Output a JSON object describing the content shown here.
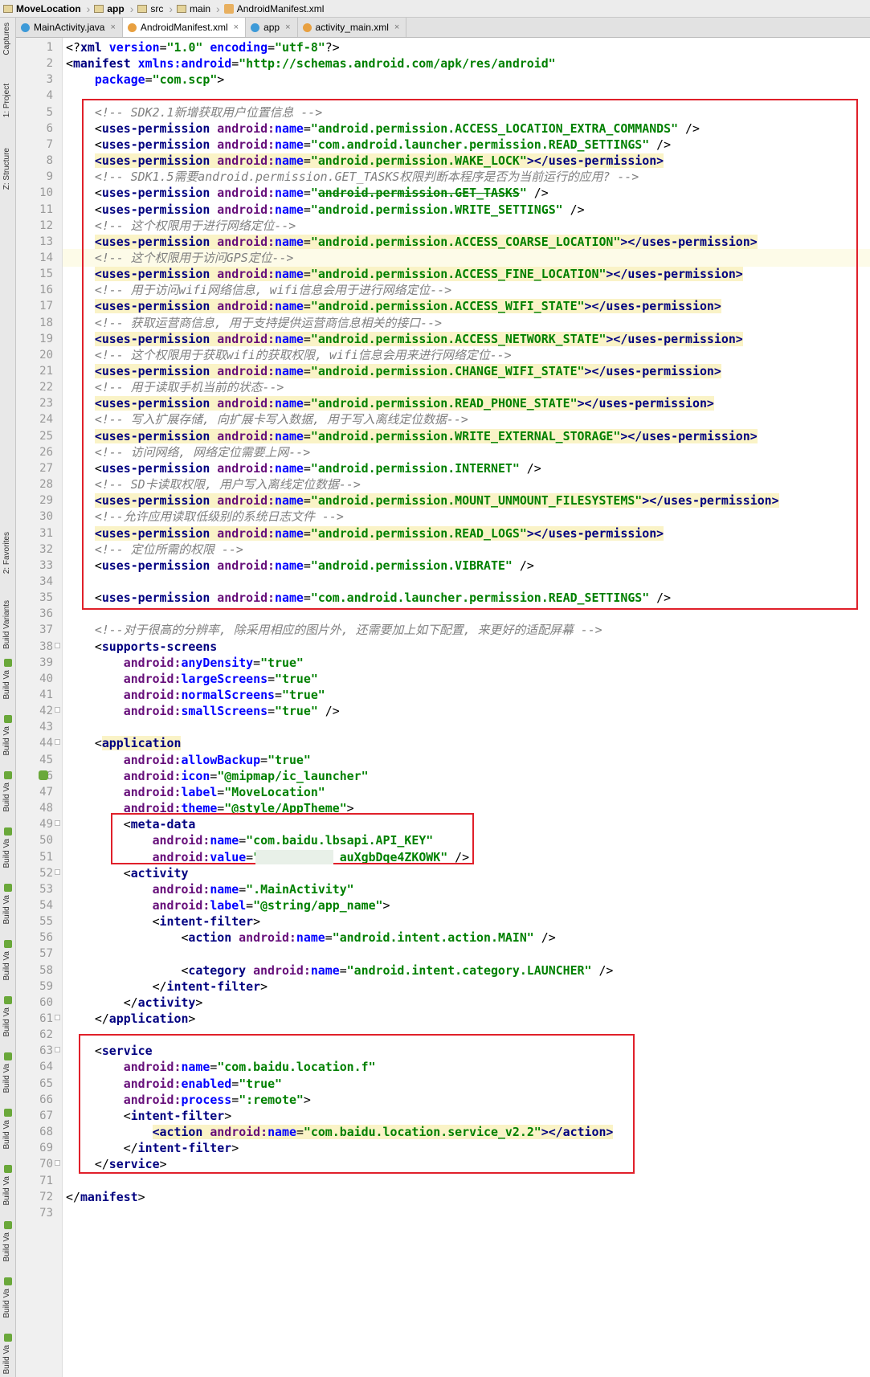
{
  "breadcrumb": [
    {
      "label": "MoveLocation",
      "type": "folder",
      "bold": true
    },
    {
      "label": "app",
      "type": "folder",
      "bold": true
    },
    {
      "label": "src",
      "type": "folder",
      "bold": false
    },
    {
      "label": "main",
      "type": "folder",
      "bold": false
    },
    {
      "label": "AndroidManifest.xml",
      "type": "xml",
      "bold": false
    }
  ],
  "tabs": [
    {
      "label": "MainActivity.java",
      "icon_color": "#3d9ad8",
      "active": false
    },
    {
      "label": "AndroidManifest.xml",
      "icon_color": "#e8a040",
      "active": true
    },
    {
      "label": "app",
      "icon_color": "#3d9ad8",
      "active": false
    },
    {
      "label": "activity_main.xml",
      "icon_color": "#e8a040",
      "active": false
    }
  ],
  "tool_windows": {
    "captures": "Captures",
    "project": "1: Project",
    "structure": "Z: Structure",
    "favorites": "2: Favorites",
    "build_variants": "Build Variants",
    "build_va": "Build Va"
  },
  "colors": {
    "tag": "#000080",
    "attr": "#0000ff",
    "namespace": "#660e7a",
    "value": "#008000",
    "comment": "#808080",
    "highlight": "#faf3c7",
    "annotation_box": "#e0202a"
  },
  "current_line": 14,
  "lines": [
    [
      [
        "pi",
        "<?"
      ],
      [
        "tg",
        "xml"
      ],
      [
        "an",
        " version"
      ],
      [
        "pi",
        "="
      ],
      [
        "av",
        "\"1.0\""
      ],
      [
        "an",
        " encoding"
      ],
      [
        "pi",
        "="
      ],
      [
        "av",
        "\"utf-8\""
      ],
      [
        "pi",
        "?>"
      ]
    ],
    [
      [
        "pi",
        "<"
      ],
      [
        "tg",
        "manifest "
      ],
      [
        "an",
        "xmlns:android"
      ],
      [
        "pi",
        "="
      ],
      [
        "av",
        "\"http://schemas.android.com/apk/res/android\""
      ]
    ],
    [
      [
        "pi",
        "    "
      ],
      [
        "an",
        "package"
      ],
      [
        "pi",
        "="
      ],
      [
        "av",
        "\"com.scp\""
      ],
      [
        "pi",
        ">"
      ]
    ],
    [],
    [
      [
        "cm",
        "    <!-- SDK2.1新增获取用户位置信息 -->"
      ]
    ],
    [
      [
        "pi",
        "    <"
      ],
      [
        "tg",
        "uses-permission "
      ],
      [
        "ns",
        "android:"
      ],
      [
        "an",
        "name"
      ],
      [
        "pi",
        "="
      ],
      [
        "av",
        "\"android.permission.ACCESS_LOCATION_EXTRA_COMMANDS\""
      ],
      [
        "pi",
        " />"
      ]
    ],
    [
      [
        "pi",
        "    <"
      ],
      [
        "tg",
        "uses-permission "
      ],
      [
        "ns",
        "android:"
      ],
      [
        "an",
        "name"
      ],
      [
        "pi",
        "="
      ],
      [
        "av",
        "\"com.android.launcher.permission.READ_SETTINGS\""
      ],
      [
        "pi",
        " />"
      ]
    ],
    [
      [
        "pi",
        "    "
      ],
      [
        "hl|tg",
        "<uses-permission "
      ],
      [
        "hl|ns",
        "android:"
      ],
      [
        "hl|an",
        "name"
      ],
      [
        "hl|pi",
        "="
      ],
      [
        "hl|av",
        "\"android.permission.WAKE_LOCK\""
      ],
      [
        "hl|tg",
        "></uses-permission>"
      ]
    ],
    [
      [
        "cm",
        "    <!-- SDK1.5需要android.permission.GET_TASKS权限判断本程序是否为当前运行的应用? -->"
      ]
    ],
    [
      [
        "pi",
        "    <"
      ],
      [
        "tg",
        "uses-permission "
      ],
      [
        "ns",
        "android:"
      ],
      [
        "an",
        "name"
      ],
      [
        "pi",
        "="
      ],
      [
        "av",
        "\""
      ],
      [
        "st|av",
        "android.permission.GET_TASKS"
      ],
      [
        "av",
        "\""
      ],
      [
        "pi",
        " />"
      ]
    ],
    [
      [
        "pi",
        "    <"
      ],
      [
        "tg",
        "uses-permission "
      ],
      [
        "ns",
        "android:"
      ],
      [
        "an",
        "name"
      ],
      [
        "pi",
        "="
      ],
      [
        "av",
        "\"android.permission.WRITE_SETTINGS\""
      ],
      [
        "pi",
        " />"
      ]
    ],
    [
      [
        "cm",
        "    <!-- 这个权限用于进行网络定位-->"
      ]
    ],
    [
      [
        "pi",
        "    "
      ],
      [
        "hl|tg",
        "<uses-permission "
      ],
      [
        "hl|ns",
        "android:"
      ],
      [
        "hl|an",
        "name"
      ],
      [
        "hl|pi",
        "="
      ],
      [
        "hl|av",
        "\"android.permission.ACCESS_COARSE_LOCATION\""
      ],
      [
        "hl|tg",
        "></uses-permission>"
      ]
    ],
    [
      [
        "cm",
        "    <!-- 这个权限用于访问GPS定位-->"
      ]
    ],
    [
      [
        "pi",
        "    "
      ],
      [
        "hl|tg",
        "<uses-permission "
      ],
      [
        "hl|ns",
        "android:"
      ],
      [
        "hl|an",
        "name"
      ],
      [
        "hl|pi",
        "="
      ],
      [
        "hl|av",
        "\"android.permission.ACCESS_FINE_LOCATION\""
      ],
      [
        "hl|tg",
        "></uses-permission>"
      ]
    ],
    [
      [
        "cm",
        "    <!-- 用于访问wifi网络信息, wifi信息会用于进行网络定位-->"
      ]
    ],
    [
      [
        "pi",
        "    "
      ],
      [
        "hl|tg",
        "<uses-permission "
      ],
      [
        "hl|ns",
        "android:"
      ],
      [
        "hl|an",
        "name"
      ],
      [
        "hl|pi",
        "="
      ],
      [
        "hl|av",
        "\"android.permission.ACCESS_WIFI_STATE\""
      ],
      [
        "hl|tg",
        "></uses-permission>"
      ]
    ],
    [
      [
        "cm",
        "    <!-- 获取运营商信息, 用于支持提供运营商信息相关的接口-->"
      ]
    ],
    [
      [
        "pi",
        "    "
      ],
      [
        "hl|tg",
        "<uses-permission "
      ],
      [
        "hl|ns",
        "android:"
      ],
      [
        "hl|an",
        "name"
      ],
      [
        "hl|pi",
        "="
      ],
      [
        "hl|av",
        "\"android.permission.ACCESS_NETWORK_STATE\""
      ],
      [
        "hl|tg",
        "></uses-permission>"
      ]
    ],
    [
      [
        "cm",
        "    <!-- 这个权限用于获取wifi的获取权限, wifi信息会用来进行网络定位-->"
      ]
    ],
    [
      [
        "pi",
        "    "
      ],
      [
        "hl|tg",
        "<uses-permission "
      ],
      [
        "hl|ns",
        "android:"
      ],
      [
        "hl|an",
        "name"
      ],
      [
        "hl|pi",
        "="
      ],
      [
        "hl|av",
        "\"android.permission.CHANGE_WIFI_STATE\""
      ],
      [
        "hl|tg",
        "></uses-permission>"
      ]
    ],
    [
      [
        "cm",
        "    <!-- 用于读取手机当前的状态-->"
      ]
    ],
    [
      [
        "pi",
        "    "
      ],
      [
        "hl|tg",
        "<uses-permission "
      ],
      [
        "hl|ns",
        "android:"
      ],
      [
        "hl|an",
        "name"
      ],
      [
        "hl|pi",
        "="
      ],
      [
        "hl|av",
        "\"android.permission.READ_PHONE_STATE\""
      ],
      [
        "hl|tg",
        "></uses-permission>"
      ]
    ],
    [
      [
        "cm",
        "    <!-- 写入扩展存储, 向扩展卡写入数据, 用于写入离线定位数据-->"
      ]
    ],
    [
      [
        "pi",
        "    "
      ],
      [
        "hl|tg",
        "<uses-permission "
      ],
      [
        "hl|ns",
        "android:"
      ],
      [
        "hl|an",
        "name"
      ],
      [
        "hl|pi",
        "="
      ],
      [
        "hl|av",
        "\"android.permission.WRITE_EXTERNAL_STORAGE\""
      ],
      [
        "hl|tg",
        "></uses-permission>"
      ]
    ],
    [
      [
        "cm",
        "    <!-- 访问网络, 网络定位需要上网-->"
      ]
    ],
    [
      [
        "pi",
        "    <"
      ],
      [
        "tg",
        "uses-permission "
      ],
      [
        "ns",
        "android:"
      ],
      [
        "an",
        "name"
      ],
      [
        "pi",
        "="
      ],
      [
        "av",
        "\"android.permission.INTERNET\""
      ],
      [
        "pi",
        " />"
      ]
    ],
    [
      [
        "cm",
        "    <!-- SD卡读取权限, 用户写入离线定位数据-->"
      ]
    ],
    [
      [
        "pi",
        "    "
      ],
      [
        "hl|tg",
        "<uses-permission "
      ],
      [
        "hl|ns",
        "android:"
      ],
      [
        "hl|an",
        "name"
      ],
      [
        "hl|pi",
        "="
      ],
      [
        "hl|av",
        "\"android.permission.MOUNT_UNMOUNT_FILESYSTEMS\""
      ],
      [
        "hl|tg",
        "></uses-permission>"
      ]
    ],
    [
      [
        "cm",
        "    <!--允许应用读取低级别的系统日志文件 -->"
      ]
    ],
    [
      [
        "pi",
        "    "
      ],
      [
        "hl|tg",
        "<uses-permission "
      ],
      [
        "hl|ns",
        "android:"
      ],
      [
        "hl|an",
        "name"
      ],
      [
        "hl|pi",
        "="
      ],
      [
        "hl|av",
        "\"android.permission.READ_LOGS\""
      ],
      [
        "hl|tg",
        "></uses-permission>"
      ]
    ],
    [
      [
        "cm",
        "    <!-- 定位所需的权限 -->"
      ]
    ],
    [
      [
        "pi",
        "    <"
      ],
      [
        "tg",
        "uses-permission "
      ],
      [
        "ns",
        "android:"
      ],
      [
        "an",
        "name"
      ],
      [
        "pi",
        "="
      ],
      [
        "av",
        "\"android.permission.VIBRATE\""
      ],
      [
        "pi",
        " />"
      ]
    ],
    [],
    [
      [
        "pi",
        "    <"
      ],
      [
        "tg",
        "uses-permission "
      ],
      [
        "ns",
        "android:"
      ],
      [
        "an",
        "name"
      ],
      [
        "pi",
        "="
      ],
      [
        "av",
        "\"com.android.launcher.permission.READ_SETTINGS\""
      ],
      [
        "pi",
        " />"
      ]
    ],
    [],
    [
      [
        "cm",
        "    <!--对于很高的分辨率, 除采用相应的图片外, 还需要加上如下配置, 来更好的适配屏幕 -->"
      ]
    ],
    [
      [
        "pi",
        "    <"
      ],
      [
        "tg",
        "supports-screens"
      ]
    ],
    [
      [
        "pi",
        "        "
      ],
      [
        "ns",
        "android:"
      ],
      [
        "an",
        "anyDensity"
      ],
      [
        "pi",
        "="
      ],
      [
        "av",
        "\"true\""
      ]
    ],
    [
      [
        "pi",
        "        "
      ],
      [
        "ns",
        "android:"
      ],
      [
        "an",
        "largeScreens"
      ],
      [
        "pi",
        "="
      ],
      [
        "av",
        "\"true\""
      ]
    ],
    [
      [
        "pi",
        "        "
      ],
      [
        "ns",
        "android:"
      ],
      [
        "an",
        "normalScreens"
      ],
      [
        "pi",
        "="
      ],
      [
        "av",
        "\"true\""
      ]
    ],
    [
      [
        "pi",
        "        "
      ],
      [
        "ns",
        "android:"
      ],
      [
        "an",
        "smallScreens"
      ],
      [
        "pi",
        "="
      ],
      [
        "av",
        "\"true\""
      ],
      [
        "pi",
        " />"
      ]
    ],
    [],
    [
      [
        "pi",
        "    <"
      ],
      [
        "hl|tg",
        "application"
      ]
    ],
    [
      [
        "pi",
        "        "
      ],
      [
        "ns",
        "android:"
      ],
      [
        "an",
        "allowBackup"
      ],
      [
        "pi",
        "="
      ],
      [
        "av",
        "\"true\""
      ]
    ],
    [
      [
        "pi",
        "        "
      ],
      [
        "ns",
        "android:"
      ],
      [
        "an",
        "icon"
      ],
      [
        "pi",
        "="
      ],
      [
        "av",
        "\"@mipmap/ic_launcher\""
      ]
    ],
    [
      [
        "pi",
        "        "
      ],
      [
        "ns",
        "android:"
      ],
      [
        "an",
        "label"
      ],
      [
        "pi",
        "="
      ],
      [
        "av",
        "\"MoveLocation\""
      ]
    ],
    [
      [
        "pi",
        "        "
      ],
      [
        "ns",
        "android:"
      ],
      [
        "an",
        "theme"
      ],
      [
        "pi",
        "="
      ],
      [
        "av",
        "\"@style/AppTheme\""
      ],
      [
        "pi",
        ">"
      ]
    ],
    [
      [
        "pi",
        "        <"
      ],
      [
        "tg",
        "meta-data"
      ]
    ],
    [
      [
        "pi",
        "            "
      ],
      [
        "ns",
        "android:"
      ],
      [
        "an",
        "name"
      ],
      [
        "pi",
        "="
      ],
      [
        "av",
        "\"com.baidu.lbsapi.API_KEY\""
      ]
    ],
    [
      [
        "pi",
        "            "
      ],
      [
        "ns",
        "android:"
      ],
      [
        "an",
        "value"
      ],
      [
        "pi",
        "="
      ],
      [
        "av",
        "\"           auXgbDqe4ZKOWK\""
      ],
      [
        "pi",
        " />"
      ]
    ],
    [
      [
        "pi",
        "        <"
      ],
      [
        "tg",
        "activity"
      ]
    ],
    [
      [
        "pi",
        "            "
      ],
      [
        "ns",
        "android:"
      ],
      [
        "an",
        "name"
      ],
      [
        "pi",
        "="
      ],
      [
        "av",
        "\".MainActivity\""
      ]
    ],
    [
      [
        "pi",
        "            "
      ],
      [
        "ns",
        "android:"
      ],
      [
        "an",
        "label"
      ],
      [
        "pi",
        "="
      ],
      [
        "av",
        "\"@string/app_name\""
      ],
      [
        "pi",
        ">"
      ]
    ],
    [
      [
        "pi",
        "            <"
      ],
      [
        "tg",
        "intent-filter"
      ],
      [
        "pi",
        ">"
      ]
    ],
    [
      [
        "pi",
        "                <"
      ],
      [
        "tg",
        "action "
      ],
      [
        "ns",
        "android:"
      ],
      [
        "an",
        "name"
      ],
      [
        "pi",
        "="
      ],
      [
        "av",
        "\"android.intent.action.MAIN\""
      ],
      [
        "pi",
        " />"
      ]
    ],
    [],
    [
      [
        "pi",
        "                <"
      ],
      [
        "tg",
        "category "
      ],
      [
        "ns",
        "android:"
      ],
      [
        "an",
        "name"
      ],
      [
        "pi",
        "="
      ],
      [
        "av",
        "\"android.intent.category.LAUNCHER\""
      ],
      [
        "pi",
        " />"
      ]
    ],
    [
      [
        "pi",
        "            </"
      ],
      [
        "tg",
        "intent-filter"
      ],
      [
        "pi",
        ">"
      ]
    ],
    [
      [
        "pi",
        "        </"
      ],
      [
        "tg",
        "activity"
      ],
      [
        "pi",
        ">"
      ]
    ],
    [
      [
        "pi",
        "    </"
      ],
      [
        "tg",
        "application"
      ],
      [
        "pi",
        ">"
      ]
    ],
    [],
    [
      [
        "pi",
        "    <"
      ],
      [
        "tg",
        "service"
      ]
    ],
    [
      [
        "pi",
        "        "
      ],
      [
        "ns",
        "android:"
      ],
      [
        "an",
        "name"
      ],
      [
        "pi",
        "="
      ],
      [
        "av",
        "\"com.baidu.location.f\""
      ]
    ],
    [
      [
        "pi",
        "        "
      ],
      [
        "ns",
        "android:"
      ],
      [
        "an",
        "enabled"
      ],
      [
        "pi",
        "="
      ],
      [
        "av",
        "\"true\""
      ]
    ],
    [
      [
        "pi",
        "        "
      ],
      [
        "ns",
        "android:"
      ],
      [
        "an",
        "process"
      ],
      [
        "pi",
        "="
      ],
      [
        "av",
        "\":remote\""
      ],
      [
        "pi",
        ">"
      ]
    ],
    [
      [
        "pi",
        "        <"
      ],
      [
        "tg",
        "intent-filter"
      ],
      [
        "pi",
        ">"
      ]
    ],
    [
      [
        "pi",
        "            "
      ],
      [
        "hl|tg",
        "<action "
      ],
      [
        "hl|ns",
        "android:"
      ],
      [
        "hl|an",
        "name"
      ],
      [
        "hl|pi",
        "="
      ],
      [
        "hl|av",
        "\"com.baidu.location.service_v2.2\""
      ],
      [
        "hl|tg",
        "></action>"
      ]
    ],
    [
      [
        "pi",
        "        </"
      ],
      [
        "tg",
        "intent-filter"
      ],
      [
        "pi",
        ">"
      ]
    ],
    [
      [
        "pi",
        "    </"
      ],
      [
        "tg",
        "service"
      ],
      [
        "pi",
        ">"
      ]
    ],
    [],
    [
      [
        "pi",
        "</"
      ],
      [
        "tg",
        "manifest"
      ],
      [
        "pi",
        ">"
      ]
    ],
    []
  ]
}
